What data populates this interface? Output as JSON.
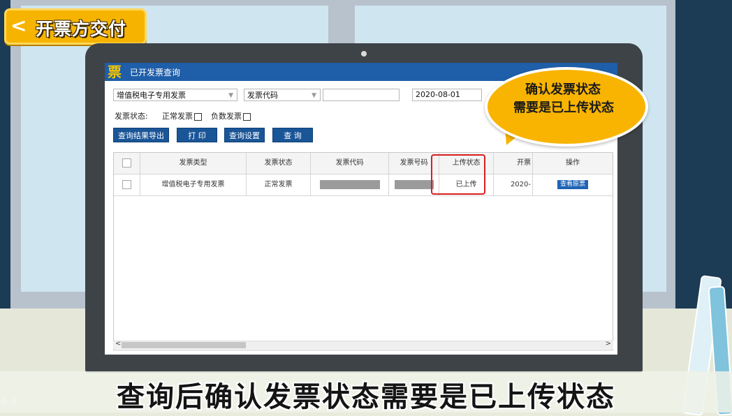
{
  "tag": {
    "arrow": "<",
    "text": "开票方交付"
  },
  "window": {
    "icon": "票",
    "title": "已开发票查询",
    "close_glyph": "⎋"
  },
  "filters": {
    "invoice_type": "增值税电子专用发票",
    "code_field": "发票代码",
    "code_value": "",
    "date_value": "2020-08-01",
    "status_label": "发票状态:",
    "normal_label": "正常发票",
    "negative_label": "负数发票"
  },
  "buttons": {
    "export": "查询结果导出",
    "print": "打 印",
    "settings": "查询设置",
    "query": "查 询"
  },
  "table": {
    "headers": [
      "发票类型",
      "发票状态",
      "发票代码",
      "发票号码",
      "上传状态",
      "开票",
      "操作"
    ],
    "rows": [
      {
        "type": "增值税电子专用发票",
        "status": "正常发票",
        "upload": "已上传",
        "date": "2020-",
        "action": "查看原票"
      }
    ]
  },
  "scrollbar": {
    "left": "<",
    "right": ">"
  },
  "bubble": {
    "line1": "确认发票状态",
    "line2": "需要是已上传状态"
  },
  "subtitle": "查询后确认发票状态需要是已上传状态",
  "colors": {
    "titlebar": "#1f5ea8",
    "button": "#1a5597",
    "highlight": "#d81e1e",
    "bubble": "#f8b400"
  }
}
